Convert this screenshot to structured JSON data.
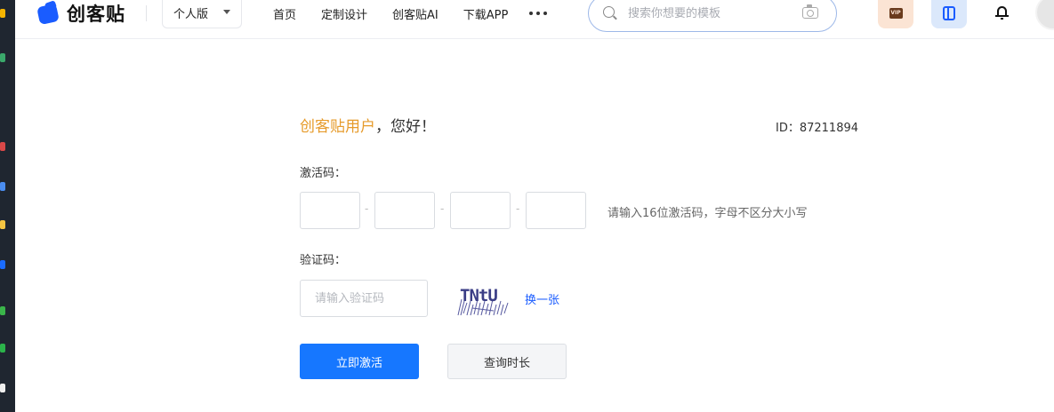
{
  "brand": {
    "name": "创客贴",
    "logo_icon": "chuangkit-logo-icon",
    "accent": "#1a5cff"
  },
  "header": {
    "edition_label": "个人版",
    "nav": [
      "首页",
      "定制设计",
      "创客贴AI",
      "下载APP"
    ],
    "more_icon": "more-dots-icon",
    "search": {
      "placeholder": "搜索你想要的模板",
      "icon": "search-icon",
      "camera_icon": "camera-icon"
    },
    "vip_icon": "vip-icon",
    "app_icon": "app-download-icon",
    "bell_icon": "bell-icon"
  },
  "activation": {
    "greeting_name": "创客贴用户",
    "greeting_text": "，您好！",
    "user_id": "ID：87211894",
    "code_label": "激活码：",
    "code_separator": "-",
    "code_hint": "请输入16位激活码，字母不区分大小写",
    "captcha_label": "验证码：",
    "captcha_placeholder": "请输入验证码",
    "captcha_text": "TNtU",
    "refresh_label": "换一张",
    "activate_button": "立即激活",
    "query_button": "查询时长",
    "primary_color": "#1677ff",
    "name_color": "#e69b2b"
  }
}
